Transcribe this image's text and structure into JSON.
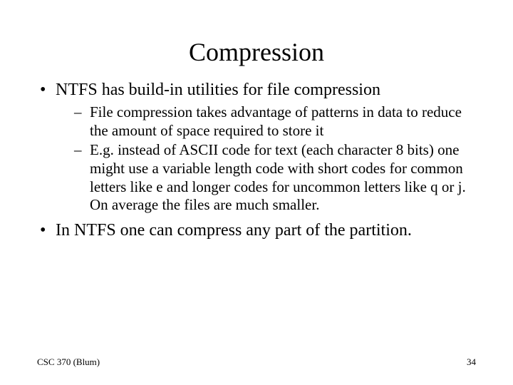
{
  "title": "Compression",
  "bullets": [
    {
      "text": "NTFS has build-in utilities for file compression",
      "sub": [
        "File compression takes advantage of patterns in data to reduce the amount of space required to store it",
        "E.g. instead of ASCII code for text (each character 8 bits) one might use a variable length code with short codes for common letters like e and longer codes for uncommon letters like q or j.  On average the files are much smaller."
      ]
    },
    {
      "text": "In NTFS one can compress any part of the partition.",
      "sub": []
    }
  ],
  "footer": {
    "left": "CSC 370 (Blum)",
    "right": "34"
  }
}
